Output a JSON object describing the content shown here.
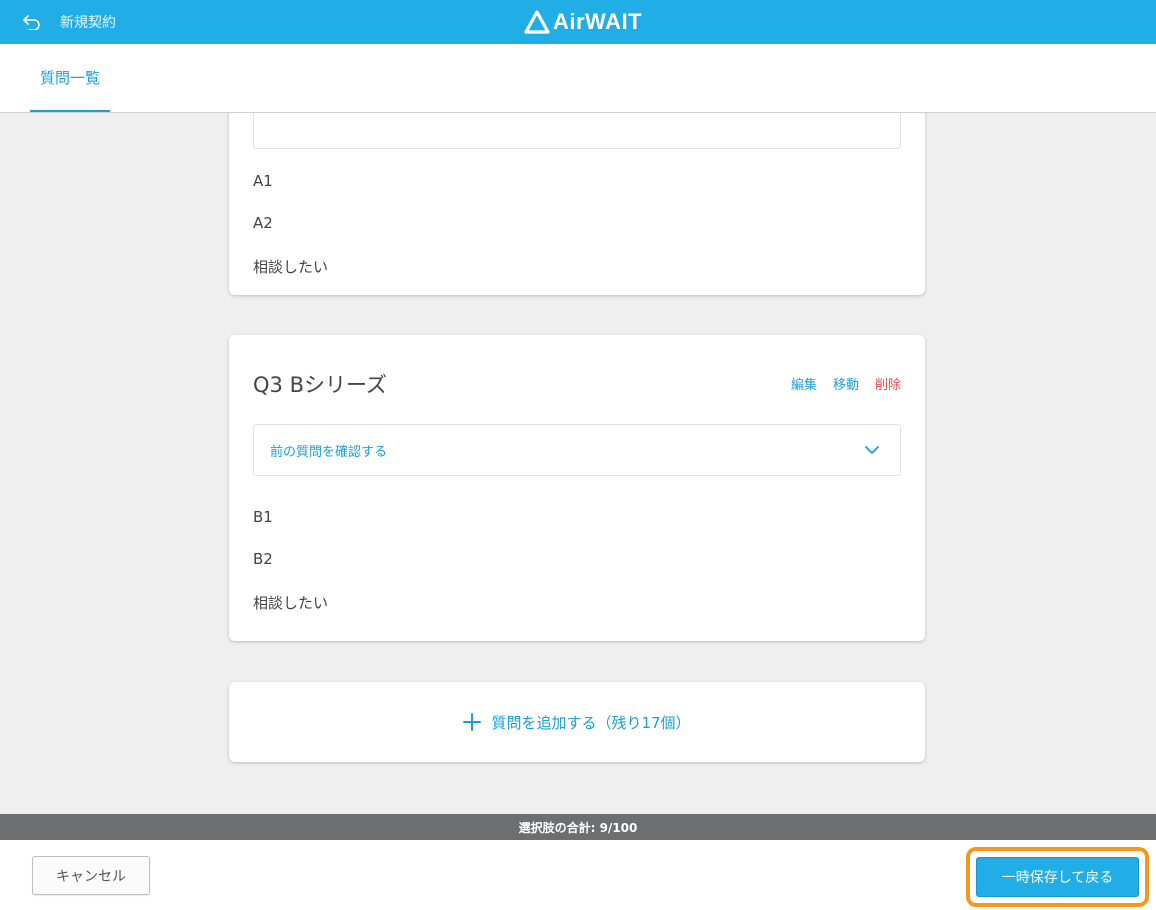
{
  "header": {
    "back_label": "新規契約",
    "logo_text": "AirWAIT",
    "back_icon": "back-arrow-icon",
    "logo_icon": "airwait-triangle-icon"
  },
  "tabs": [
    {
      "label": "質問一覧",
      "active": true
    }
  ],
  "questions": [
    {
      "options": [
        "A1",
        "A2",
        "相談したい"
      ]
    },
    {
      "title": "Q3 Bシリーズ",
      "actions": {
        "edit": "編集",
        "move": "移動",
        "delete": "削除"
      },
      "prev_label": "前の質問を確認する",
      "options": [
        "B1",
        "B2",
        "相談したい"
      ]
    }
  ],
  "add_question": {
    "label": "質問を追加する（残り17個）",
    "icon": "plus-icon"
  },
  "summary": "選択肢の合計: 9/100",
  "footer": {
    "cancel_label": "キャンセル",
    "save_label": "一時保存して戻る"
  },
  "colors": {
    "brand": "#21ade5",
    "link": "#1a9fd6",
    "danger": "#e54b4b",
    "highlight": "#f39a1c"
  }
}
